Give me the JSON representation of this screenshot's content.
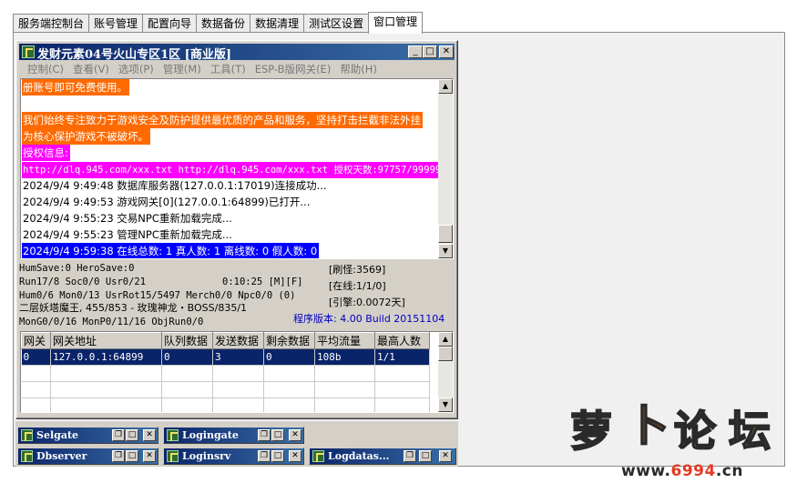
{
  "tabs": [
    {
      "label": "服务端控制台",
      "active": false
    },
    {
      "label": "账号管理",
      "active": false
    },
    {
      "label": "配置向导",
      "active": false
    },
    {
      "label": "数据备份",
      "active": false
    },
    {
      "label": "数据清理",
      "active": false
    },
    {
      "label": "测试区设置",
      "active": false
    },
    {
      "label": "窗口管理",
      "active": true
    }
  ],
  "window": {
    "title": "发财元素04号火山专区1区 [商业版]",
    "menu": [
      "控制(C)",
      "查看(V)",
      "选项(P)",
      "管理(M)",
      "工具(T)",
      "ESP-B版网关(E)",
      "帮助(H)"
    ]
  },
  "log": {
    "lines": [
      {
        "text": "册账号即可免费使用。",
        "bg": "#ff6a00",
        "fg": "#ffffff",
        "mono": false
      },
      {
        "text": "",
        "bg": "",
        "fg": "#000000",
        "mono": false
      },
      {
        "text": "我们始终专注致力于游戏安全及防护提供最优质的产品和服务，坚持打击拦截非法外挂",
        "bg": "#ff6a00",
        "fg": "#ffffff",
        "mono": false
      },
      {
        "text": "为核心保护游戏不被破坏。",
        "bg": "#ff6a00",
        "fg": "#ffffff",
        "mono": false
      },
      {
        "text": "授权信息:",
        "bg": "#ff00ff",
        "fg": "#ffffff",
        "mono": false
      },
      {
        "text": "http://dlq.945.com/xxx.txt http://dlq.945.com/xxx.txt 授权天数:97757/99999",
        "bg": "#ff00ff",
        "fg": "#ffffff",
        "mono": true
      },
      {
        "text": "2024/9/4 9:49:48 数据库服务器(127.0.0.1:17019)连接成功...",
        "bg": "",
        "fg": "#000000",
        "mono": false
      },
      {
        "text": "2024/9/4 9:49:53 游戏网关[0](127.0.0.1:64899)已打开...",
        "bg": "",
        "fg": "#000000",
        "mono": false
      },
      {
        "text": "2024/9/4 9:55:23 交易NPC重新加载完成...",
        "bg": "",
        "fg": "#000000",
        "mono": false
      },
      {
        "text": "2024/9/4 9:55:23 管理NPC重新加载完成...",
        "bg": "",
        "fg": "#000000",
        "mono": false
      },
      {
        "text": "2024/9/4 9:59:38 在线总数: 1 真人数: 1 离线数: 0 假人数: 0",
        "bg": "#0000ff",
        "fg": "#ffffff",
        "mono": false
      }
    ]
  },
  "status": {
    "hum_save": "HumSave:0 HeroSave:0",
    "run": "Run17/8 Soc0/0 Usr0/21",
    "timer": "0:10:25 [M][F]",
    "hum": "Hum0/6 Mon0/13 UsrRot15/5497 Merch0/0 Npc0/0 (0)",
    "boss": "二层妖塔魔王, 455/853 - 玫瑰神龙・BOSS/835/1",
    "mon": "MonG0/0/16 MonP0/11/16 ObjRun0/0",
    "refresh": "[刷怪:3569]",
    "online": "[在线:1/1/0]",
    "engine": "[引擎:0.0072天]",
    "version": "程序版本: 4.00 Build 20151104"
  },
  "grid": {
    "headers": [
      "网关",
      "网关地址",
      "队列数据",
      "发送数据",
      "剩余数据",
      "平均流量",
      "最高人数"
    ],
    "rows": [
      [
        "0",
        "127.0.0.1:64899",
        "0",
        "3",
        "0",
        "108b",
        "1/1"
      ]
    ]
  },
  "minimized": [
    {
      "title": "Selgate"
    },
    {
      "title": "Logingate"
    },
    {
      "title": "Dbserver"
    },
    {
      "title": "Loginsrv"
    },
    {
      "title": "Logdatas..."
    }
  ],
  "watermark": {
    "chars": [
      "萝",
      "卜",
      "论",
      "坛"
    ],
    "url_prefix": "www.",
    "url_highlight": "6994",
    "url_suffix": ".cn"
  },
  "colors": {
    "titlebar": "#0a246a",
    "selection": "#0a246a",
    "log_orange": "#ff6a00",
    "log_magenta": "#ff00ff",
    "log_blue": "#0000ff"
  }
}
